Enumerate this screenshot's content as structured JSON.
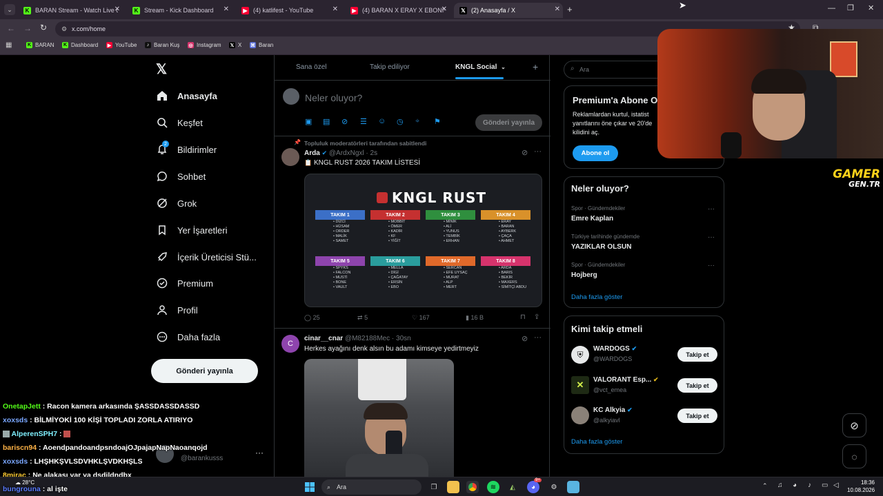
{
  "browser": {
    "tabs": [
      {
        "label": "BARAN Stream - Watch Live on",
        "icon": "kick-icon"
      },
      {
        "label": "Stream - Kick Dashboard",
        "icon": "kick-icon"
      },
      {
        "label": "(4) katlifest - YouTube",
        "icon": "youtube-icon"
      },
      {
        "label": "(4) BARAN X ERAY X EBONİVON",
        "icon": "youtube-icon"
      },
      {
        "label": "(2) Anasayfa / X",
        "icon": "x-icon"
      }
    ],
    "url": "x.com/home",
    "bookmarks": [
      "BARAN",
      "Dashboard",
      "YouTube",
      "Baran Kuş",
      "Instagram",
      "X",
      "Baran"
    ]
  },
  "nav": {
    "items": [
      "Anasayfa",
      "Keşfet",
      "Bildirimler",
      "Sohbet",
      "Grok",
      "Yer İşaretleri",
      "İçerik Üreticisi Stü...",
      "Premium",
      "Profil",
      "Daha fazla"
    ],
    "notif_badge": "2",
    "post_button": "Gönderi yayınla",
    "account_handle": "@barankusss"
  },
  "timeline": {
    "tabs": [
      "Sana özel",
      "Takip ediliyor",
      "KNGL Social"
    ],
    "composer_placeholder": "Neler oluyor?",
    "composer_button": "Gönderi yayınla",
    "pinned_label": "Topluluk moderatörleri tarafından sabitlendi",
    "tweet1": {
      "name": "Arda",
      "handle": "@ArdxNgxl",
      "time": "· 2s",
      "text": "KNGL RUST 2026 TAKIM LİSTESİ",
      "image_title": "KNGL RUST",
      "teams": [
        {
          "name": "TAKIM 1",
          "color": "#3b6fc7",
          "members": [
            "DİZCİ",
            "HÜSAM",
            "ORDER",
            "MALİK",
            "SAMET"
          ]
        },
        {
          "name": "TAKIM 2",
          "color": "#c53030",
          "members": [
            "MOBBİT",
            "ÖMER",
            "KADİR",
            "KF",
            "YİĞİT"
          ]
        },
        {
          "name": "TAKIM 3",
          "color": "#2f8f3e",
          "members": [
            "MİNİK",
            "ALİ",
            "YUNUS",
            "TEMBİK",
            "ERHAN"
          ]
        },
        {
          "name": "TAKIM 4",
          "color": "#d9912a",
          "members": [
            "ERAY",
            "BARAN",
            "AYBERK",
            "ÇAÇA",
            "AHMET"
          ]
        },
        {
          "name": "TAKIM 5",
          "color": "#8e44ad",
          "members": [
            "SPYKS",
            "FALCON",
            "MUSTİ",
            "BONE",
            "VAULT"
          ]
        },
        {
          "name": "TAKIM 6",
          "color": "#2a9d9d",
          "members": [
            "MELLA",
            "DİGİ",
            "ÇAĞATAY",
            "ERSİN",
            "EBO"
          ]
        },
        {
          "name": "TAKIM 7",
          "color": "#e0692a",
          "members": [
            "SERCAN",
            "EFE UYSAÇ",
            "MURAT",
            "ALP",
            "MERT"
          ]
        },
        {
          "name": "TAKIM 8",
          "color": "#d6336c",
          "members": [
            "ARDA",
            "BARIS",
            "BEKİR",
            "MAXERS",
            "SİMİTÇİ ABDU"
          ]
        }
      ],
      "replies": "25",
      "reposts": "5",
      "likes": "167",
      "views": "16 B"
    },
    "tweet2": {
      "name": "cinar__cnar",
      "handle": "@M82188Mec",
      "time": "· 30sn",
      "text": "Herkes ayağını denk alsın bu adamı kimseye yedirtmeyiz",
      "avatar_letter": "C"
    }
  },
  "right": {
    "search_placeholder": "Ara",
    "premium": {
      "title": "Premium'a Abone O",
      "text": "Reklamlardan kurtul, istatist yanıtlarını öne çıkar ve 20'de kilidini aç.",
      "button": "Abone ol"
    },
    "trends_title": "Neler oluyor?",
    "trends": [
      {
        "meta": "Spor · Gündemdekiler",
        "title": "Emre Kaplan"
      },
      {
        "meta": "Türkiye tarihinde gündemde",
        "title": "YAZIKLAR OLSUN"
      },
      {
        "meta": "Spor · Gündemdekiler",
        "title": "Hojberg"
      }
    ],
    "show_more": "Daha fazla göster",
    "wtf_title": "Kimi takip etmeli",
    "suggestions": [
      {
        "name": "WARDOGS",
        "handle": "@WARDOGS",
        "button": "Takip et"
      },
      {
        "name": "VALORANT Esp...",
        "handle": "@vct_emea",
        "button": "Takip et"
      },
      {
        "name": "KC Alkyia",
        "handle": "@alkyiavl",
        "button": "Takip et"
      }
    ],
    "show_more2": "Daha fazla göster"
  },
  "overlay": {
    "watermark_line1": "GAMER",
    "watermark_line2": "GEN.TR"
  },
  "chat": [
    {
      "user": "OnetapJett",
      "color": "#53fc18",
      "msg": ": Racon kamera arkasında ŞASSDASSDASSD"
    },
    {
      "user": "xoxsds",
      "color": "#7aa7ff",
      "msg": ": BİLMİYOKİ 100 KİŞİ TOPLADI ZORLA ATIRIYO"
    },
    {
      "user": "AlperenSPH7",
      "color": "#7ff0ff",
      "msg": ":"
    },
    {
      "user": "bariscn94",
      "color": "#ffb347",
      "msg": ": AoendpandoandpsndoajOJpajapNapNaoanqojd"
    },
    {
      "user": "xoxsds",
      "color": "#7aa7ff",
      "msg": ": LHŞHKŞVLSDVHKLŞVDKHŞLS"
    },
    {
      "user": "8mirac",
      "color": "#ffcc33",
      "msg": ": Ne alakası var ya dşdjldndbx"
    },
    {
      "user": "bungrouna",
      "color": "#5b7cff",
      "msg": ": al işte"
    }
  ],
  "taskbar": {
    "search": "Ara",
    "weather": "28°C",
    "time": "18:36",
    "date": "10.08.2026",
    "discord_badge": "9+"
  }
}
